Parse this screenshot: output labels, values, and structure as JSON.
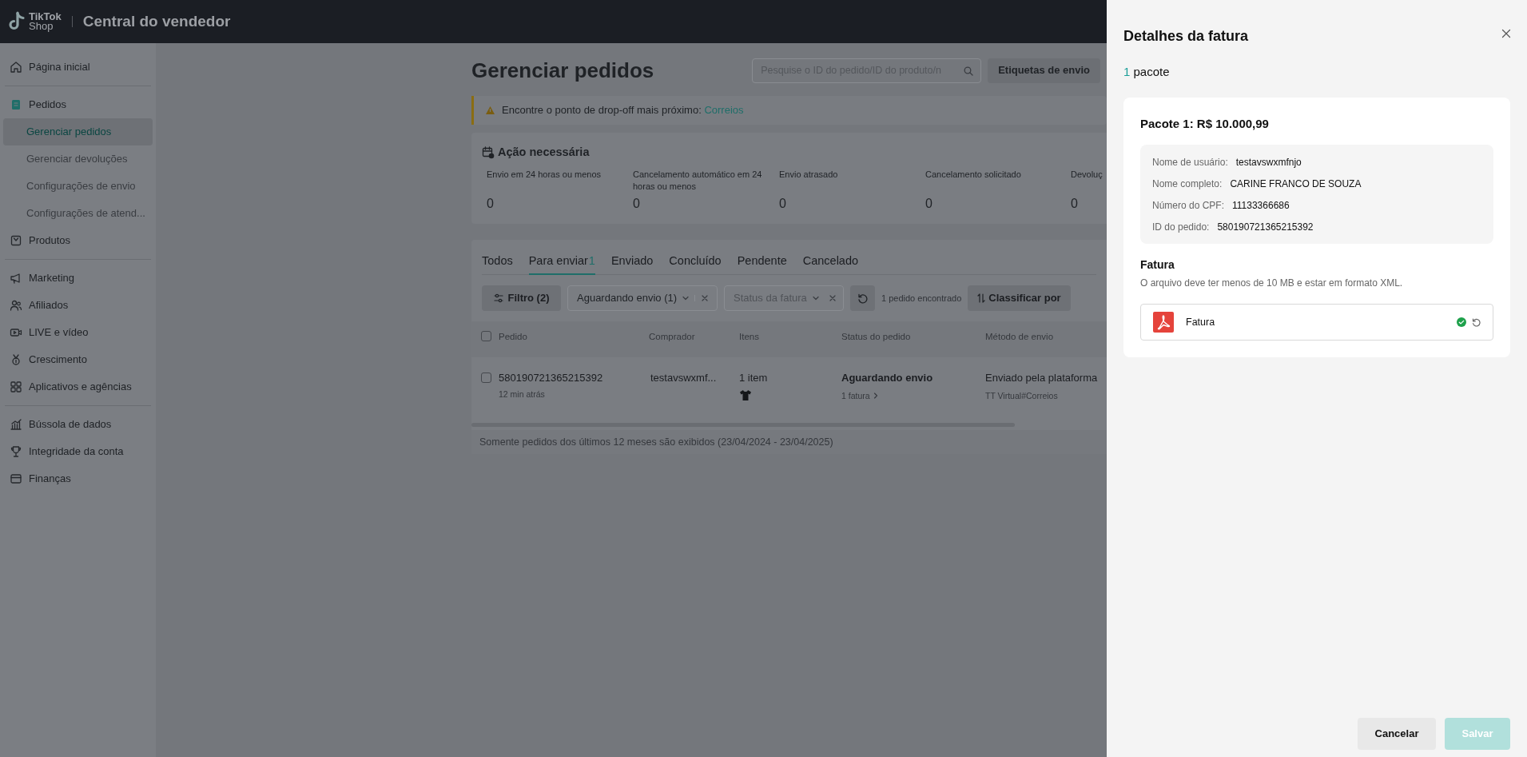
{
  "header": {
    "logo_top": "TikTok",
    "logo_bottom": "Shop",
    "title": "Central do vendedor"
  },
  "sidebar": {
    "sections": [
      {
        "items": [
          {
            "label": "Página inicial",
            "active": false
          }
        ]
      },
      {
        "items": [
          {
            "label": "Pedidos",
            "active": true,
            "expanded": true,
            "children": [
              {
                "label": "Gerenciar pedidos",
                "selected": true
              },
              {
                "label": "Gerenciar devoluções",
                "selected": false
              },
              {
                "label": "Configurações de envio",
                "selected": false
              },
              {
                "label": "Configurações de atend...",
                "selected": false
              }
            ]
          },
          {
            "label": "Produtos",
            "active": false
          }
        ]
      },
      {
        "items": [
          {
            "label": "Marketing",
            "active": false
          },
          {
            "label": "Afiliados",
            "active": false
          },
          {
            "label": "LIVE e vídeo",
            "active": false
          },
          {
            "label": "Crescimento",
            "active": false
          },
          {
            "label": "Aplicativos e agências",
            "active": false
          }
        ]
      },
      {
        "items": [
          {
            "label": "Bússola de dados",
            "active": false
          },
          {
            "label": "Integridade da conta",
            "active": false
          },
          {
            "label": "Finanças",
            "active": false
          }
        ]
      }
    ]
  },
  "page": {
    "title": "Gerenciar pedidos",
    "search_placeholder": "Pesquise o ID do pedido/ID do produto/n",
    "labels_button": "Etiquetas de envio",
    "alert": {
      "text": "Encontre o ponto de drop-off mais próximo:",
      "link": "Correios"
    },
    "action": {
      "title": "Ação necessária",
      "metrics": [
        {
          "label": "Envio em 24 horas ou menos",
          "value": "0"
        },
        {
          "label": "Cancelamento automático em 24 horas ou menos",
          "value": "0"
        },
        {
          "label": "Envio atrasado",
          "value": "0"
        },
        {
          "label": "Cancelamento solicitado",
          "value": "0"
        },
        {
          "label": "Devoluç",
          "value": "0"
        }
      ]
    },
    "tabs": [
      {
        "label": "Todos",
        "selected": false
      },
      {
        "label": "Para enviar",
        "count": "1",
        "selected": true
      },
      {
        "label": "Enviado",
        "selected": false
      },
      {
        "label": "Concluído",
        "selected": false
      },
      {
        "label": "Pendente",
        "selected": false
      },
      {
        "label": "Cancelado",
        "selected": false
      }
    ],
    "filters": {
      "filter_button": "Filtro",
      "filter_count": "(2)",
      "chips": [
        {
          "kind": "value",
          "text": "Aguardando envio (1)"
        },
        {
          "kind": "placeholder",
          "text": "Status da fatura"
        }
      ],
      "result_count": "1 pedido encontrado",
      "sort_button": "Classificar por"
    },
    "table": {
      "select_all_checked": false,
      "columns": [
        "Pedido",
        "Comprador",
        "Itens",
        "Status do pedido",
        "Método de envio"
      ],
      "rows": [
        {
          "checked": false,
          "order_id": "580190721365215392",
          "time": "12 min atrás",
          "buyer": "testavswxmf...",
          "items": "1 item",
          "status": "Aguardando envio",
          "invoice_link": "1 fatura",
          "shipping": "Enviado pela plataforma",
          "shipping_detail": "TT Virtual#Correios"
        }
      ]
    },
    "footer_note": "Somente pedidos dos últimos 12 meses são exibidos (23/04/2024 - 23/04/2025)"
  },
  "drawer": {
    "title": "Detalhes da fatura",
    "package_count": "1",
    "package_label": "pacote",
    "package": {
      "title": "Pacote 1: R$ 10.000,99",
      "fields": [
        {
          "label": "Nome de usuário:",
          "value": "testavswxmfnjo"
        },
        {
          "label": "Nome completo:",
          "value": "CARINE FRANCO DE SOUZA"
        },
        {
          "label": "Número do CPF:",
          "value": "11133366686"
        },
        {
          "label": "ID do pedido:",
          "value": "580190721365215392"
        }
      ],
      "invoice_title": "Fatura",
      "invoice_hint": "O arquivo deve ter menos de 10 MB e estar em formato XML.",
      "file": {
        "name": "Fatura",
        "uploaded": true
      }
    },
    "cancel_button": "Cancelar",
    "save_button": {
      "label": "Salvar",
      "disabled": true
    }
  }
}
